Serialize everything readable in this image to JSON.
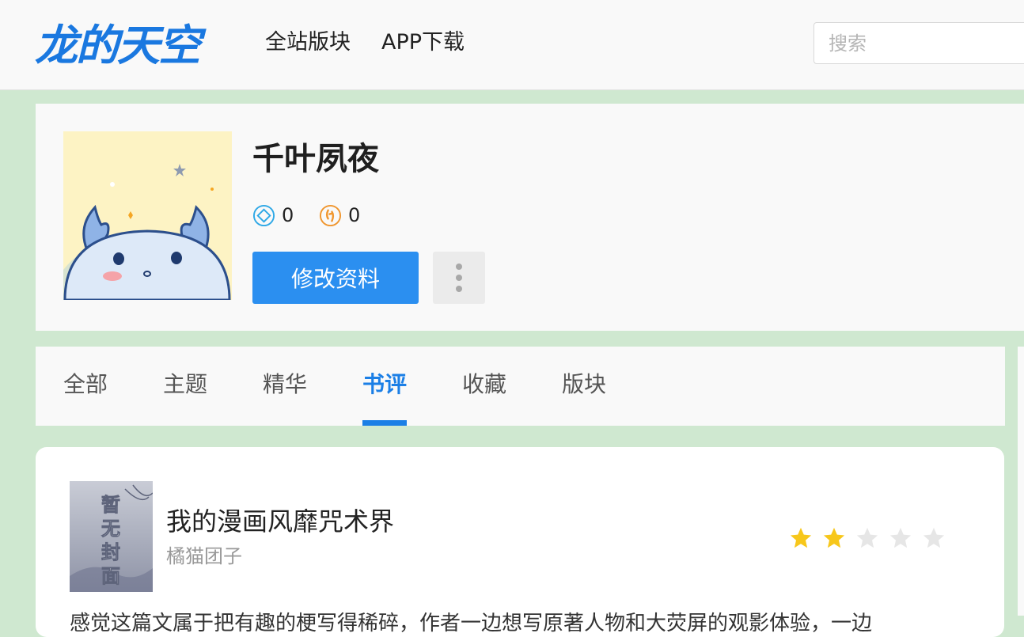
{
  "site": {
    "logo_text": "龙的天空",
    "nav": [
      "全站版块",
      "APP下载"
    ],
    "search_placeholder": "搜索"
  },
  "profile": {
    "username": "千叶夙夜",
    "stat_diamond": "0",
    "stat_coin": "0",
    "edit_button": "修改资料"
  },
  "tabs": [
    "全部",
    "主题",
    "精华",
    "书评",
    "收藏",
    "版块"
  ],
  "active_tab": 3,
  "review": {
    "cover_text": "暂无封面",
    "book_title": "我的漫画风靡咒术界",
    "author": "橘猫团子",
    "rating": 2,
    "rating_max": 5,
    "excerpt": "感觉这篇文属于把有趣的梗写得稀碎，作者一边想写原著人物和大荧屏的观影体验，一边"
  },
  "colors": {
    "brand": "#1b7fe6",
    "button": "#2b8ff0",
    "star_on": "#f7c71b",
    "star_off": "#e6e6e6",
    "page_bg": "#cfe8d0"
  }
}
